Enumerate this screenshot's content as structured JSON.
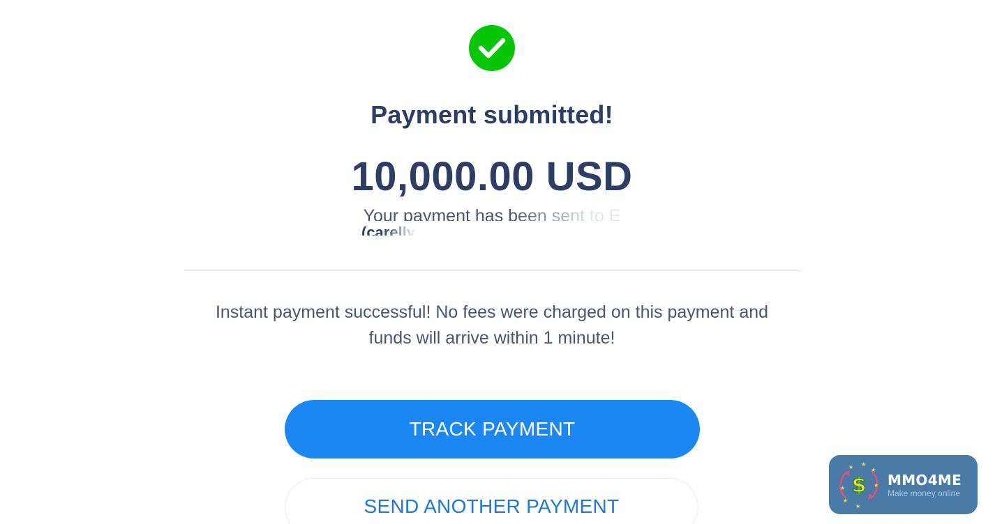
{
  "status": {
    "icon": "check-circle-icon",
    "success_color": "#06c606"
  },
  "headline": "Payment submitted!",
  "amount": "10,000.00 USD",
  "recipient": {
    "sent_to_text": "Your payment has been sent to",
    "recipient_name_partial": "E",
    "handle_partial": "(carelly"
  },
  "notice": {
    "line1": "Instant payment successful! No fees were charged on this payment and",
    "line2": "funds will arrive within 1 minute!"
  },
  "actions": {
    "track_label": "TRACK PAYMENT",
    "send_another_label": "SEND ANOTHER PAYMENT",
    "primary_color": "#1b87f3"
  },
  "watermark": {
    "title": "MMO4ME",
    "subtitle": "Make money online",
    "logo_icon": "dollar-coin-icon",
    "background_color": "#4a7ba6"
  }
}
